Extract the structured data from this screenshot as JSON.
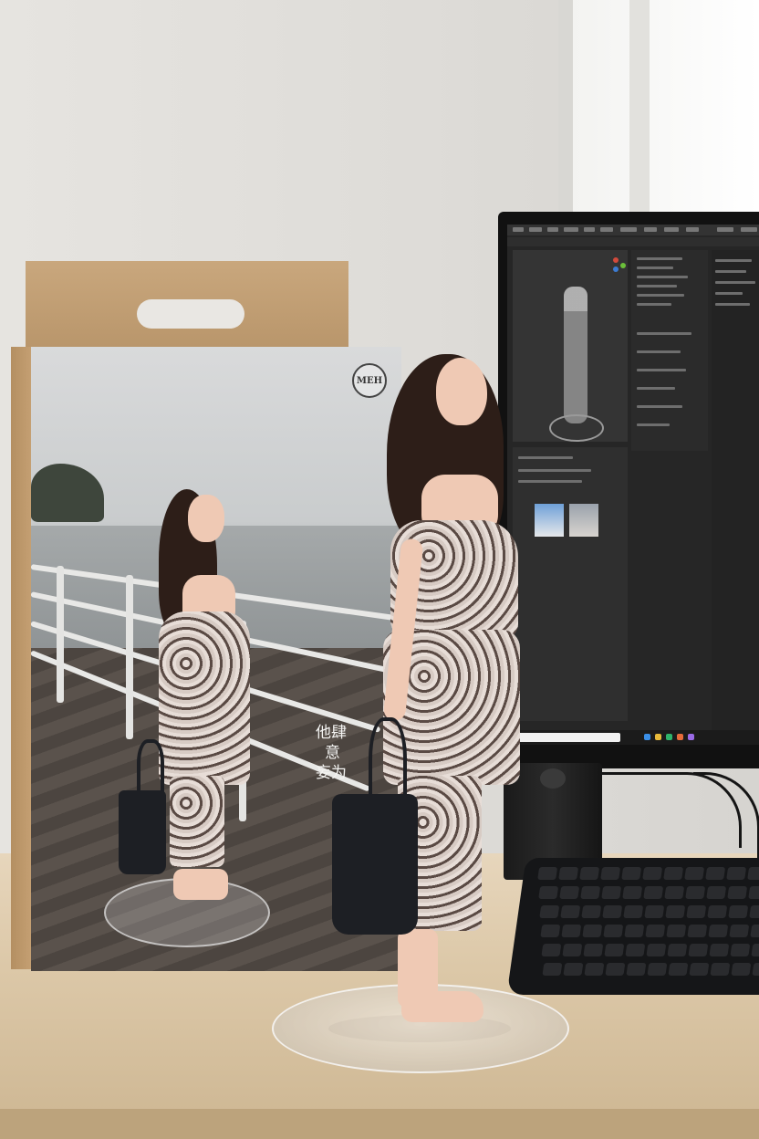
{
  "scene": {
    "box": {
      "logo_text": "MEH",
      "vertical_text": [
        "他肆",
        "意",
        "妄为"
      ]
    },
    "colors": {
      "wall": "#dedcd8",
      "desk": "#dcc8a8",
      "box_cardboard": "#c9a77d",
      "monitor": "#111111",
      "keyboard": "#151618",
      "hair": "#2d1e18",
      "bag": "#1d1f24"
    }
  }
}
